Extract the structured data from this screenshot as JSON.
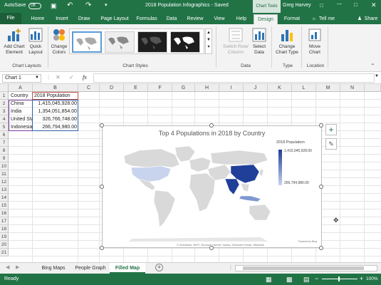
{
  "title_bar": {
    "autosave_label": "AutoSave",
    "autosave_state": "Off",
    "document_title": "2018 Population Infographics  -  Saved",
    "context_label": "Chart Tools",
    "user_name": "Greg Harvey"
  },
  "ribbon_tabs": [
    {
      "label": "File"
    },
    {
      "label": "Home"
    },
    {
      "label": "Insert"
    },
    {
      "label": "Draw"
    },
    {
      "label": "Page Layout"
    },
    {
      "label": "Formulas"
    },
    {
      "label": "Data"
    },
    {
      "label": "Review"
    },
    {
      "label": "View"
    },
    {
      "label": "Help"
    },
    {
      "label": "Design"
    },
    {
      "label": "Format"
    }
  ],
  "tell_me": "Tell me",
  "share_label": "Share",
  "ribbon": {
    "add_chart_element": "Add Chart Element",
    "quick_layout": "Quick Layout",
    "change_colors": "Change Colors",
    "switch_row_column": "Switch Row/ Column",
    "select_data": "Select Data",
    "change_chart_type": "Change Chart Type",
    "move_chart": "Move Chart",
    "groups": {
      "chart_layouts": "Chart Layouts",
      "chart_styles": "Chart Styles",
      "data": "Data",
      "type": "Type",
      "location": "Location"
    }
  },
  "formula_bar": {
    "name_box": "Chart 1",
    "fx": "fx"
  },
  "columns": [
    "A",
    "B",
    "C",
    "D",
    "E",
    "F",
    "G",
    "H",
    "I",
    "J",
    "K",
    "L",
    "M",
    "N"
  ],
  "rows": [
    "1",
    "2",
    "3",
    "4",
    "5",
    "6",
    "7",
    "8",
    "9",
    "10",
    "11",
    "12",
    "13",
    "14",
    "15",
    "16",
    "17",
    "18",
    "19",
    "20",
    "21"
  ],
  "table": {
    "headers": [
      "Country",
      "2018 Population"
    ],
    "rows": [
      [
        "China",
        "1,415,045,928.00"
      ],
      [
        "India",
        "1,354,051,854.00"
      ],
      [
        "United States",
        "326,766,748.00"
      ],
      [
        "Indonesia",
        "266,794,980.00"
      ]
    ]
  },
  "chart": {
    "title": "Top 4 Populations in 2018 by Country",
    "legend_title": "2018 Population",
    "legend_max": "1,415,045,928.00",
    "legend_min": "266,794,980.00",
    "powered_by": "Powered by Bing",
    "attribution": "© GeoNames, MSFT, Microsoft, NavInfo, Navteq, Thinkware Extract, Wikipedia",
    "colors": {
      "high": "#1f3f99",
      "mid": "#7f97d1",
      "low": "#c8d3ee",
      "land": "#d9d9d9"
    }
  },
  "chart_data": {
    "type": "map",
    "title": "Top 4 Populations in 2018 by Country",
    "categories": [
      "China",
      "India",
      "United States",
      "Indonesia"
    ],
    "values": [
      1415045928,
      1354051854,
      326766748,
      266794980
    ],
    "legend": "2018 Population"
  },
  "sheet_tabs": [
    {
      "label": "Bing Maps"
    },
    {
      "label": "People Graph"
    },
    {
      "label": "Filled Map"
    }
  ],
  "status": {
    "ready": "Ready",
    "zoom": "100%"
  }
}
